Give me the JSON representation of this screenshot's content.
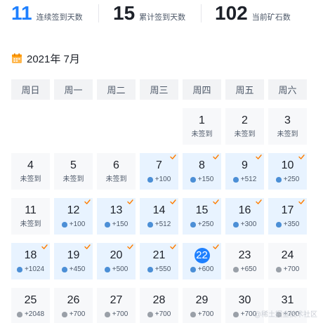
{
  "stats": [
    {
      "value": "11",
      "label": "连续签到天数"
    },
    {
      "value": "15",
      "label": "累计签到天数"
    },
    {
      "value": "102",
      "label": "当前矿石数"
    }
  ],
  "calendar": {
    "month_title": "2021年 7月",
    "weekdays": [
      "周日",
      "周一",
      "周二",
      "周三",
      "周四",
      "周五",
      "周六"
    ],
    "days": [
      {
        "day": "1",
        "status": "未签到",
        "signed": false,
        "checked": false
      },
      {
        "day": "2",
        "status": "未签到",
        "signed": false,
        "checked": false
      },
      {
        "day": "3",
        "status": "未签到",
        "signed": false,
        "checked": false
      },
      {
        "day": "4",
        "status": "未签到",
        "signed": false,
        "checked": false
      },
      {
        "day": "5",
        "status": "未签到",
        "signed": false,
        "checked": false
      },
      {
        "day": "6",
        "status": "未签到",
        "signed": false,
        "checked": false
      },
      {
        "day": "7",
        "status": "+100",
        "signed": true,
        "checked": true
      },
      {
        "day": "8",
        "status": "+150",
        "signed": true,
        "checked": true
      },
      {
        "day": "9",
        "status": "+512",
        "signed": true,
        "checked": true
      },
      {
        "day": "10",
        "status": "+250",
        "signed": true,
        "checked": true
      },
      {
        "day": "11",
        "status": "未签到",
        "signed": false,
        "checked": false
      },
      {
        "day": "12",
        "status": "+100",
        "signed": true,
        "checked": true
      },
      {
        "day": "13",
        "status": "+150",
        "signed": true,
        "checked": true
      },
      {
        "day": "14",
        "status": "+512",
        "signed": true,
        "checked": true
      },
      {
        "day": "15",
        "status": "+250",
        "signed": true,
        "checked": true
      },
      {
        "day": "16",
        "status": "+300",
        "signed": true,
        "checked": true
      },
      {
        "day": "17",
        "status": "+350",
        "signed": true,
        "checked": true
      },
      {
        "day": "18",
        "status": "+1024",
        "signed": true,
        "checked": true
      },
      {
        "day": "19",
        "status": "+450",
        "signed": true,
        "checked": true
      },
      {
        "day": "20",
        "status": "+500",
        "signed": true,
        "checked": true
      },
      {
        "day": "21",
        "status": "+550",
        "signed": true,
        "checked": true
      },
      {
        "day": "22",
        "status": "+600",
        "signed": true,
        "checked": true,
        "today": true
      },
      {
        "day": "23",
        "status": "+650",
        "signed": false,
        "checked": false
      },
      {
        "day": "24",
        "status": "+700",
        "signed": false,
        "checked": false
      },
      {
        "day": "25",
        "status": "+2048",
        "signed": false,
        "checked": false
      },
      {
        "day": "26",
        "status": "+700",
        "signed": false,
        "checked": false
      },
      {
        "day": "27",
        "status": "+700",
        "signed": false,
        "checked": false
      },
      {
        "day": "28",
        "status": "+700",
        "signed": false,
        "checked": false
      },
      {
        "day": "29",
        "status": "+700",
        "signed": false,
        "checked": false
      },
      {
        "day": "30",
        "status": "+700",
        "signed": false,
        "checked": false
      },
      {
        "day": "31",
        "status": "+700",
        "signed": false,
        "checked": false
      }
    ],
    "first_weekday_index": 4
  },
  "watermark": "@稀土掘金技术社区",
  "colors": {
    "accent": "#1e80ff",
    "signed_bg": "#e8f3ff",
    "unsigned_bg": "#f7f8fa",
    "check": "#ff7d00"
  },
  "icons": {
    "calendar": "calendar-icon",
    "ore_signed": "ore-blue-icon",
    "ore_unsigned": "ore-grey-icon",
    "check": "check-icon"
  }
}
